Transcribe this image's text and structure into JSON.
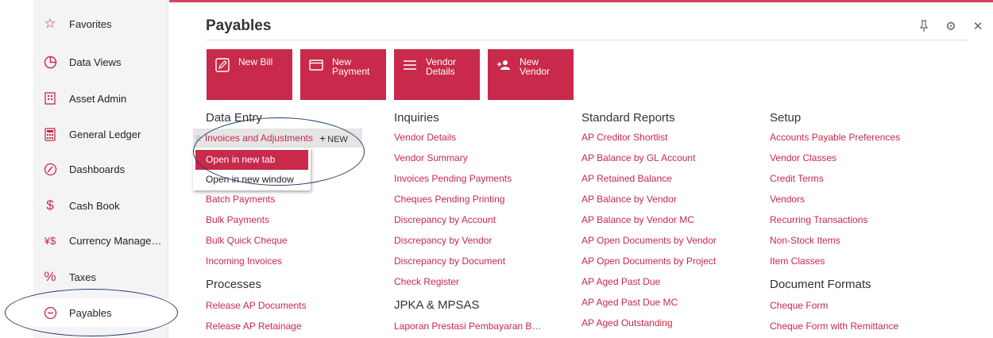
{
  "sidebar": {
    "items": [
      {
        "label": "Favorites",
        "icon": "star-icon"
      },
      {
        "label": "Data Views",
        "icon": "pie-chart-icon"
      },
      {
        "label": "Asset Admin",
        "icon": "building-icon"
      },
      {
        "label": "General Ledger",
        "icon": "calculator-icon"
      },
      {
        "label": "Dashboards",
        "icon": "gauge-icon"
      },
      {
        "label": "Cash Book",
        "icon": "dollar-icon"
      },
      {
        "label": "Currency Manage…",
        "icon": "currency-icon"
      },
      {
        "label": "Taxes",
        "icon": "percent-icon"
      },
      {
        "label": "Payables",
        "icon": "minus-circle-icon"
      }
    ]
  },
  "header": {
    "title": "Payables"
  },
  "tiles": [
    {
      "label": "New Bill",
      "icon": "edit-icon"
    },
    {
      "label": "New\nPayment",
      "icon": "card-icon"
    },
    {
      "label": "Vendor\nDetails",
      "icon": "list-icon"
    },
    {
      "label": "New\nVendor",
      "icon": "add-person-icon"
    }
  ],
  "columns": {
    "data_entry": {
      "title": "Data Entry",
      "links": [
        "Batch Payments",
        "Bulk Payments",
        "Bulk Quick Cheque",
        "Incoming Invoices"
      ]
    },
    "processes": {
      "title": "Processes",
      "links": [
        "Release AP Documents",
        "Release AP Retainage"
      ]
    },
    "inquiries": {
      "title": "Inquiries",
      "links": [
        "Vendor Details",
        "Vendor Summary",
        "Invoices Pending Payments",
        "Cheques Pending Printing",
        "Discrepancy by Account",
        "Discrepancy by Vendor",
        "Discrepancy by Document",
        "Check Register"
      ]
    },
    "jpka": {
      "title": "JPKA & MPSAS",
      "links": [
        "Laporan Prestasi Pembayaran B…"
      ]
    },
    "standard_reports": {
      "title": "Standard Reports",
      "links": [
        "AP Creditor Shortlist",
        "AP Balance by GL Account",
        "AP Retained Balance",
        "AP Balance by Vendor",
        "AP Balance by Vendor MC",
        "AP Open Documents by Vendor",
        "AP Open Documents by Project",
        "AP Aged Past Due",
        "AP Aged Past Due MC",
        "AP Aged Outstanding"
      ]
    },
    "setup": {
      "title": "Setup",
      "links": [
        "Accounts Payable Preferences",
        "Vendor Classes",
        "Credit Terms",
        "Vendors",
        "Recurring Transactions",
        "Non-Stock Items",
        "Item Classes"
      ]
    },
    "document_formats": {
      "title": "Document Formats",
      "links": [
        "Cheque Form",
        "Cheque Form with Remittance"
      ]
    }
  },
  "hovered_link": {
    "label": "Invoices and Adjustments",
    "new_label": "NEW"
  },
  "context_menu": {
    "open_new_tab": "Open in new tab",
    "open_new_window": "Open in new window"
  },
  "colors": {
    "accent": "#c9294a",
    "annotation": "#1d3f6b"
  }
}
